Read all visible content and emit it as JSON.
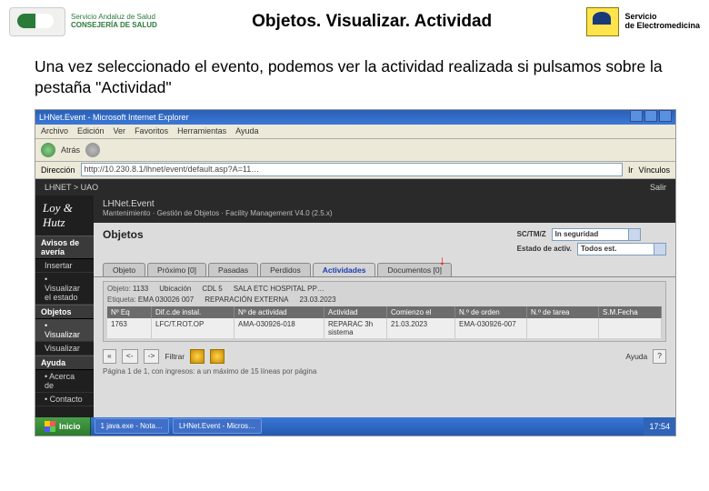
{
  "header": {
    "org_line1": "Servicio Andaluz de Salud",
    "org_line2": "CONSEJERÍA DE SALUD",
    "title": "Objetos. Visualizar. Actividad",
    "right_line1": "Servicio",
    "right_line2": "de Electromedicina"
  },
  "body_text": "Una vez seleccionado el evento, podemos ver la actividad realizada si pulsamos sobre la pestaña \"Actividad\"",
  "ie": {
    "window_title": "LHNet.Event - Microsoft Internet Explorer",
    "menu": [
      "Archivo",
      "Edición",
      "Ver",
      "Favoritos",
      "Herramientas",
      "Ayuda"
    ],
    "back": "Atrás",
    "addr_label": "Dirección",
    "addr_url": "http://10.230.8.1/lhnet/event/default.asp?A=11…",
    "go": "Ir",
    "links": "Vínculos"
  },
  "app": {
    "crumb": "LHNET > UAO",
    "exit": "Salir",
    "brand": "Loy & Hutz",
    "app_title": "LHNet.Event",
    "app_sub": "Mantenimiento · Gestión de Objetos · Facility Management V4.0 (2.5.x)",
    "side_groups": {
      "avisos": "Avisos de avería",
      "objetos": "Objetos",
      "ayuda": "Ayuda"
    },
    "side_items": {
      "insertar": "Insertar",
      "visualizar": "• Visualizar el estado",
      "obj_visualizar": "• Visualizar",
      "visualizar2": "Visualizar",
      "acerca": "• Acerca de",
      "contacto": "• Contacto"
    },
    "heading": "Objetos",
    "filters": {
      "scn_label": "SC/TM/Z",
      "scn_value": "In seguridad",
      "estado_label": "Estado de activ.",
      "estado_value": "Todos est."
    },
    "tabs": {
      "objeto": "Objeto",
      "proximo": "Próximo [0]",
      "pasadas": "Pasadas",
      "perdidos": "Perdidos",
      "actividades": "Actividades",
      "documentos": "Documentos [0]"
    },
    "details": {
      "obj_label": "Objeto:",
      "obj_val": "1133",
      "etq_label": "Etiqueta:",
      "etq_val": "EMA 030026 007",
      "desc": "REPARACIÓN EXTERNA",
      "ubic_label": "Ubicación",
      "ubic_val": "CDL 5",
      "fecha": "23.03.2023",
      "sala": "SALA ETC HOSPITAL PP…"
    },
    "cols": {
      "c1": "Nº Eq",
      "c2": "Dif.c.de instal.",
      "c3": "Nº de actividad",
      "c4": "Actividad",
      "c5": "Comienzo el",
      "c6": "N.º de orden",
      "c7": "N.º de tarea",
      "c8": "S.M.Fecha"
    },
    "row": {
      "c1": "1763",
      "c2": "LFC/T.ROT.OP",
      "c3": "AMA-030926-018",
      "c4": "REPARAC 3h sistema",
      "c5": "21.03.2023",
      "c6": "EMA-030926-007",
      "c7": "",
      "c8": ""
    },
    "pager": {
      "first": "«",
      "prev": "<-",
      "next": "->",
      "filter_label": "Filtrar",
      "help": "Ayuda",
      "q": "?"
    },
    "page_info_1": "Página 1 de 1, con ingresos: a un máximo de",
    "page_info_val": "15",
    "page_info_2": "líneas por página"
  },
  "taskbar": {
    "start": "Inicio",
    "btn1": "1 java.exe - Nota…",
    "btn2": "LHNet.Event - Micros…",
    "time": "17:54"
  }
}
